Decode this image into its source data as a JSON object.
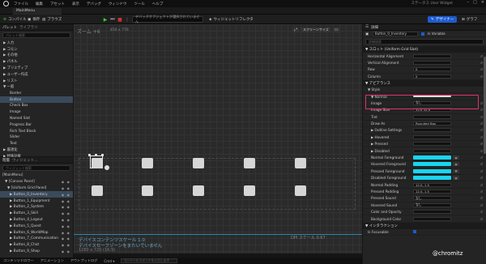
{
  "menu": [
    "ファイル",
    "編集",
    "アセット",
    "表示",
    "デバッグ",
    "ウィンドウ",
    "ツール",
    "ヘルプ"
  ],
  "menu_right": "ステータス User Widget",
  "window_controls": [
    "–",
    "□",
    "✕"
  ],
  "tab": {
    "title": "MainMenu"
  },
  "toolbar": {
    "compile": "コンパイル",
    "save": "保存",
    "browse": "ブラウズ",
    "debug_filter": "デバッグオブジェクトが選択されていません",
    "widget_reflector": "ウィジェットリフレクタ",
    "designer": "デザイナー",
    "graph": "グラフ"
  },
  "palette": {
    "tab1": "パレット",
    "tab2": "ライブラリ",
    "search_placeholder": "パレット検索",
    "items": [
      {
        "label": "▶ 入力",
        "type": "cat"
      },
      {
        "label": "▶ コモン",
        "type": "cat"
      },
      {
        "label": "▶ その他",
        "type": "cat"
      },
      {
        "label": "▶ パネル",
        "type": "cat"
      },
      {
        "label": "▶ プリミティブ",
        "type": "cat"
      },
      {
        "label": "▶ ユーザー作成",
        "type": "cat"
      },
      {
        "label": "▶ リスト",
        "type": "cat"
      },
      {
        "label": "▼ 一般",
        "type": "cat"
      },
      {
        "label": "Border",
        "type": "item"
      },
      {
        "label": "Button",
        "type": "sel"
      },
      {
        "label": "Check Box",
        "type": "item"
      },
      {
        "label": "Image",
        "type": "item"
      },
      {
        "label": "Named Slot",
        "type": "item"
      },
      {
        "label": "Progress Bar",
        "type": "item"
      },
      {
        "label": "Rich Text Block",
        "type": "item"
      },
      {
        "label": "Slider",
        "type": "item"
      },
      {
        "label": "Text",
        "type": "item"
      },
      {
        "label": "▶ 最適化",
        "type": "cat"
      },
      {
        "label": "▶ 特殊効果",
        "type": "cat"
      }
    ]
  },
  "hierarchy": {
    "tab1": "階層",
    "tab2": "ウィジェット...",
    "search_placeholder": "ウィジェット検索",
    "items": [
      {
        "label": "[MainMenu]",
        "indent": 0
      },
      {
        "label": "▼ [Canvas Panel]",
        "indent": 1
      },
      {
        "label": "▼ [Uniform Grid Panel]",
        "indent": 2
      },
      {
        "label": "▶ Button_0_Inventory",
        "indent": 3,
        "sel": true
      },
      {
        "label": "▶ Button_1_Equipment",
        "indent": 3
      },
      {
        "label": "▶ Button_2_System",
        "indent": 3
      },
      {
        "label": "▶ Button_3_Skill",
        "indent": 3
      },
      {
        "label": "▶ Button_4_Logout",
        "indent": 3
      },
      {
        "label": "▶ Button_5_Quest",
        "indent": 3
      },
      {
        "label": "▶ Button_6_WorldMap",
        "indent": 3
      },
      {
        "label": "▶ Button_7_Communication",
        "indent": 3
      },
      {
        "label": "▶ Button_8_Chat",
        "indent": 3
      },
      {
        "label": "▶ Button_9_Shop",
        "indent": 3
      }
    ]
  },
  "canvas": {
    "zoom": "ズーム +6",
    "size_readout": "450 x 776",
    "screen_size": "スクリーンサイズ",
    "dpi_status": "DPI スケール 0.67",
    "device_scale": "デバイスコンテンツスケール 1.0",
    "safe_zone": "デバイスセーフゾーンをまたいでいません",
    "resolution": "1280 x 720 (16:9)"
  },
  "details": {
    "title": "詳細",
    "name": "Button_0_Inventory",
    "is_variable": "Is Variable",
    "search_placeholder": "詳細検索",
    "slot_header": "▼ スロット (Uniform Grid Slot)",
    "rows": [
      {
        "label": "Horizontal Alignment",
        "value": ""
      },
      {
        "label": "Vertical Alignment",
        "value": ""
      },
      {
        "label": "Row",
        "value": "0"
      },
      {
        "label": "Column",
        "value": "0"
      }
    ],
    "appearance": "▼ アピアランス",
    "style": "▼ Style",
    "normal": "▼ Normal",
    "style_rows": [
      {
        "label": "Image",
        "value": "なし"
      },
      {
        "label": "Image Size",
        "value": "32.0   32.0"
      },
      {
        "label": "Tint",
        "value": ""
      },
      {
        "label": "Draw As",
        "value": "Rounded Box"
      },
      {
        "label": "▶ Outline Settings",
        "value": ""
      },
      {
        "label": "▶ Hovered",
        "value": ""
      },
      {
        "label": "▶ Pressed",
        "value": ""
      },
      {
        "label": "▶ Disabled",
        "value": ""
      }
    ],
    "color_rows": [
      {
        "label": "Normal Foreground",
        "color": "#19d5f0"
      },
      {
        "label": "Hovered Foreground",
        "color": "#19d5f0"
      },
      {
        "label": "Pressed Foreground",
        "color": "#19d5f0"
      },
      {
        "label": "Disabled Foreground",
        "color": "#19d5f0"
      }
    ],
    "tail_rows": [
      {
        "label": "Normal Padding",
        "value": "12.0, 1.5"
      },
      {
        "label": "Pressed Padding",
        "value": "12.0, 1.5"
      },
      {
        "label": "Pressed Sound",
        "value": "なし"
      },
      {
        "label": "Hovered Sound",
        "value": "なし"
      },
      {
        "label": "Color and Opacity",
        "value": ""
      },
      {
        "label": "Background Color",
        "value": ""
      }
    ],
    "interaction": "▼ インタラクション",
    "is_focusable": "Is Focusable"
  },
  "bottombar": [
    "コンテンツドロワー",
    "アニメーション",
    "アウトプットログ",
    "Cmd ▾"
  ],
  "bottom_input_placeholder": "コンソールコマンドを入力します",
  "watermark": "@chromitz",
  "colors": {
    "accent": "#1e5bd0",
    "highlight_box": "#e0306e",
    "cyan": "#19d5f0"
  }
}
